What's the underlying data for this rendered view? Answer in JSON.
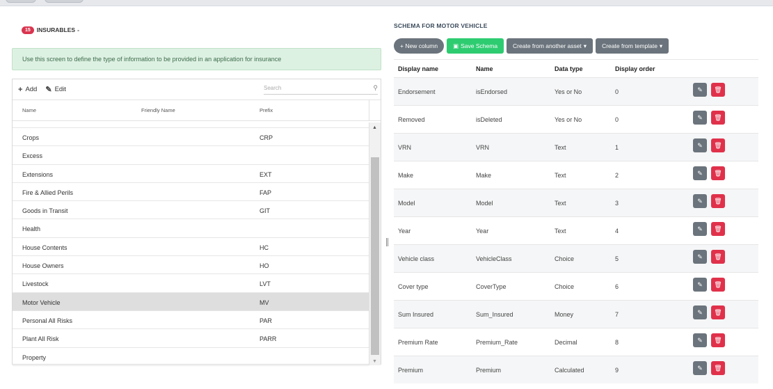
{
  "left": {
    "badge_count": "15",
    "title": "INSURABLES",
    "caret": "▾",
    "alert": "Use this screen to define the type of information to be provided in an application for insurance",
    "toolbar": {
      "add_label": "Add",
      "edit_label": "Edit",
      "search_placeholder": "Search"
    },
    "columns": {
      "name": "Name",
      "friendly": "Friendly Name",
      "prefix": "Prefix"
    },
    "rows": [
      {
        "name": "Crops",
        "prefix": "CRP",
        "selected": false
      },
      {
        "name": "Excess",
        "prefix": "",
        "selected": false
      },
      {
        "name": "Extensions",
        "prefix": "EXT",
        "selected": false
      },
      {
        "name": "Fire & Allied Perils",
        "prefix": "FAP",
        "selected": false
      },
      {
        "name": "Goods in Transit",
        "prefix": "GIT",
        "selected": false
      },
      {
        "name": "Health",
        "prefix": "",
        "selected": false
      },
      {
        "name": "House Contents",
        "prefix": "HC",
        "selected": false
      },
      {
        "name": "House Owners",
        "prefix": "HO",
        "selected": false
      },
      {
        "name": "Livestock",
        "prefix": "LVT",
        "selected": false
      },
      {
        "name": "Motor Vehicle",
        "prefix": "MV",
        "selected": true
      },
      {
        "name": "Personal All Risks",
        "prefix": "PAR",
        "selected": false
      },
      {
        "name": "Plant All Risk",
        "prefix": "PARR",
        "selected": false
      },
      {
        "name": "Property",
        "prefix": "",
        "selected": false
      }
    ]
  },
  "right": {
    "title": "SCHEMA FOR MOTOR VEHICLE",
    "buttons": {
      "new_column": "+ New column",
      "save_schema": "Save Schema",
      "create_asset": "Create from another asset",
      "create_template": "Create from template"
    },
    "columns": {
      "display_name": "Display name",
      "name": "Name",
      "data_type": "Data type",
      "display_order": "Display order"
    },
    "rows": [
      {
        "display_name": "Endorsement",
        "name": "isEndorsed",
        "data_type": "Yes or No",
        "order": "0"
      },
      {
        "display_name": "Removed",
        "name": "isDeleted",
        "data_type": "Yes or No",
        "order": "0"
      },
      {
        "display_name": "VRN",
        "name": "VRN",
        "data_type": "Text",
        "order": "1"
      },
      {
        "display_name": "Make",
        "name": "Make",
        "data_type": "Text",
        "order": "2"
      },
      {
        "display_name": "Model",
        "name": "Model",
        "data_type": "Text",
        "order": "3"
      },
      {
        "display_name": "Year",
        "name": "Year",
        "data_type": "Text",
        "order": "4"
      },
      {
        "display_name": "Vehicle class",
        "name": "VehicleClass",
        "data_type": "Choice",
        "order": "5"
      },
      {
        "display_name": "Cover type",
        "name": "CoverType",
        "data_type": "Choice",
        "order": "6"
      },
      {
        "display_name": "Sum Insured",
        "name": "Sum_Insured",
        "data_type": "Money",
        "order": "7"
      },
      {
        "display_name": "Premium Rate",
        "name": "Premium_Rate",
        "data_type": "Decimal",
        "order": "8"
      },
      {
        "display_name": "Premium",
        "name": "Premium",
        "data_type": "Calculated",
        "order": "9"
      }
    ]
  },
  "colors": {
    "badge": "#d9354f",
    "save": "#2ecc71",
    "delete": "#e0314b",
    "neutral_button": "#6b747c",
    "alert_bg": "#ddf1e3"
  }
}
